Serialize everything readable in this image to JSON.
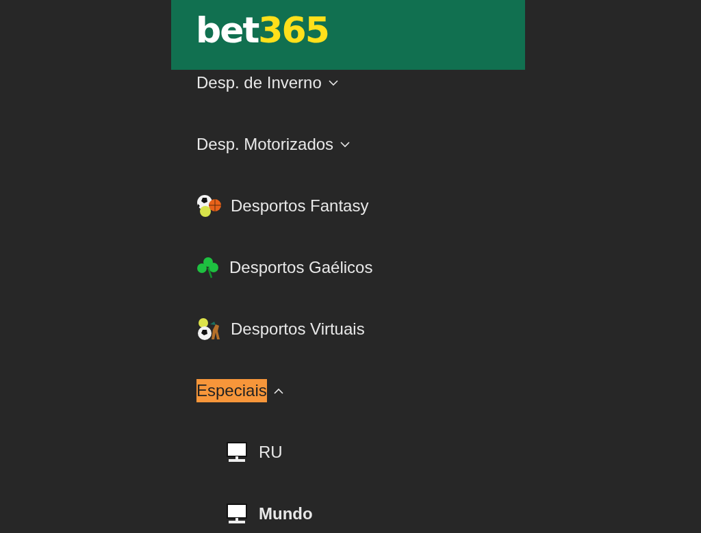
{
  "header": {
    "logo": {
      "part_1": "bet",
      "part_2": "365"
    }
  },
  "menu": [
    {
      "kind": "group",
      "label": "Desp. de Inverno",
      "expanded": false,
      "highlighted": false
    },
    {
      "kind": "group",
      "label": "Desp. Motorizados",
      "expanded": false,
      "highlighted": false
    },
    {
      "kind": "fantasy",
      "label": "Desportos Fantasy"
    },
    {
      "kind": "gaelic",
      "label": "Desportos Gaélicos"
    },
    {
      "kind": "virtual",
      "label": "Desportos Virtuais"
    },
    {
      "kind": "group",
      "label": "Especiais",
      "expanded": true,
      "highlighted": true,
      "children": [
        {
          "kind": "sublink",
          "label": "RU",
          "selected": false
        },
        {
          "kind": "sublink",
          "label": "Mundo",
          "selected": true
        }
      ]
    }
  ]
}
